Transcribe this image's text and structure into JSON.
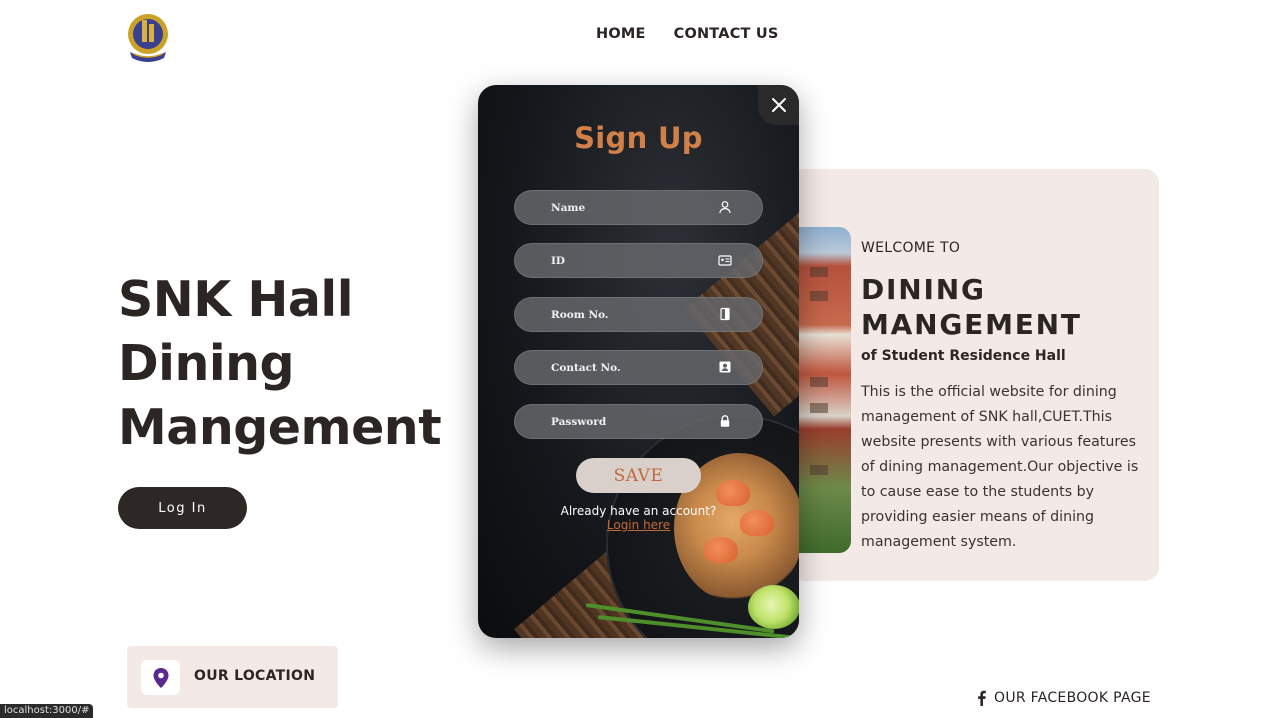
{
  "header": {
    "nav": [
      {
        "label": "HOME"
      },
      {
        "label": "CONTACT US"
      }
    ]
  },
  "hero": {
    "title_lines": [
      "SNK Hall",
      "Dining",
      "Mangement"
    ],
    "login_label": "Log In"
  },
  "welcome": {
    "kicker": "WELCOME TO",
    "title_lines": [
      "DINING",
      "MANGEMENT"
    ],
    "subtitle": "of Student Residence Hall",
    "description": "This is the official website for dining management of SNK hall,CUET.This website presents with various features of dining management.Our objective is to cause ease to the students by providing easier means of dining management system."
  },
  "footer": {
    "location_label": "OUR LOCATION",
    "facebook_label": "OUR FACEBOOK PAGE",
    "status_url": "localhost:3000/#"
  },
  "signup": {
    "title": "Sign Up",
    "fields": [
      {
        "placeholder": "Name",
        "icon": "user-icon"
      },
      {
        "placeholder": "ID",
        "icon": "id-card-icon"
      },
      {
        "placeholder": "Room No.",
        "icon": "door-icon"
      },
      {
        "placeholder": "Contact No.",
        "icon": "contact-card-icon"
      },
      {
        "placeholder": "Password",
        "icon": "lock-icon"
      }
    ],
    "save_label": "SAVE",
    "already_text": "Already have an account?",
    "login_link": "Login here"
  },
  "colors": {
    "accent": "#d2804a",
    "dark": "#2b2523",
    "card_bg": "#f3e9e6",
    "location_pin": "#5b2a91"
  }
}
